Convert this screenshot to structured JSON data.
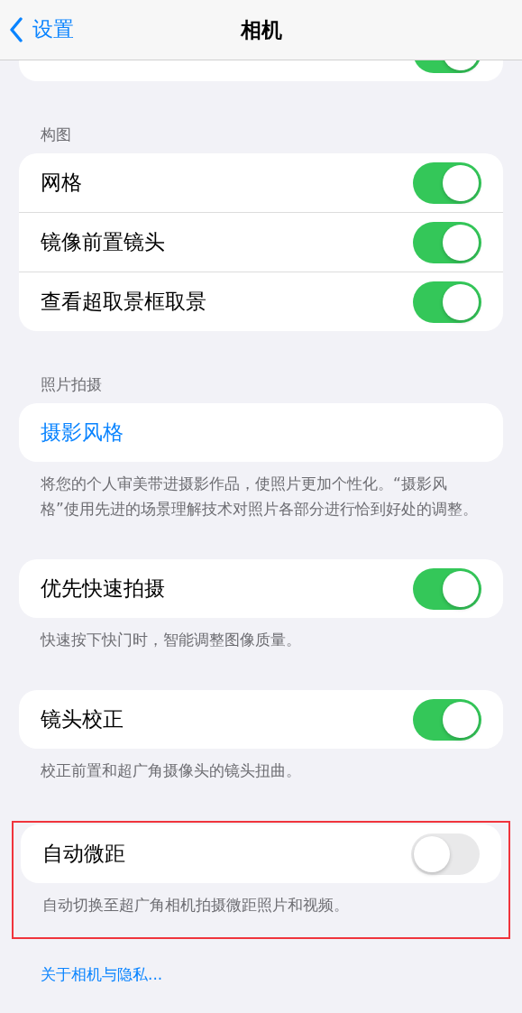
{
  "nav": {
    "back": "设置",
    "title": "相机"
  },
  "top_card": {
    "on": true
  },
  "sections": [
    {
      "header": "构图",
      "rows": [
        {
          "kind": "toggle",
          "label": "网格",
          "on": true
        },
        {
          "kind": "toggle",
          "label": "镜像前置镜头",
          "on": true
        },
        {
          "kind": "toggle",
          "label": "查看超取景框取景",
          "on": true
        }
      ],
      "highlighted": false
    },
    {
      "header": "照片拍摄",
      "rows": [
        {
          "kind": "link",
          "label": "摄影风格"
        }
      ],
      "footer": "将您的个人审美带进摄影作品，使照片更加个性化。“摄影风格”使用先进的场景理解技术对照片各部分进行恰到好处的调整。",
      "highlighted": false
    },
    {
      "rows": [
        {
          "kind": "toggle",
          "label": "优先快速拍摄",
          "on": true
        }
      ],
      "footer": "快速按下快门时，智能调整图像质量。",
      "highlighted": false
    },
    {
      "rows": [
        {
          "kind": "toggle",
          "label": "镜头校正",
          "on": true
        }
      ],
      "footer": "校正前置和超广角摄像头的镜头扭曲。",
      "highlighted": false
    },
    {
      "rows": [
        {
          "kind": "toggle",
          "label": "自动微距",
          "on": false
        }
      ],
      "footer": "自动切换至超广角相机拍摄微距照片和视频。",
      "highlighted": true
    }
  ],
  "privacy_link": "关于相机与隐私..."
}
